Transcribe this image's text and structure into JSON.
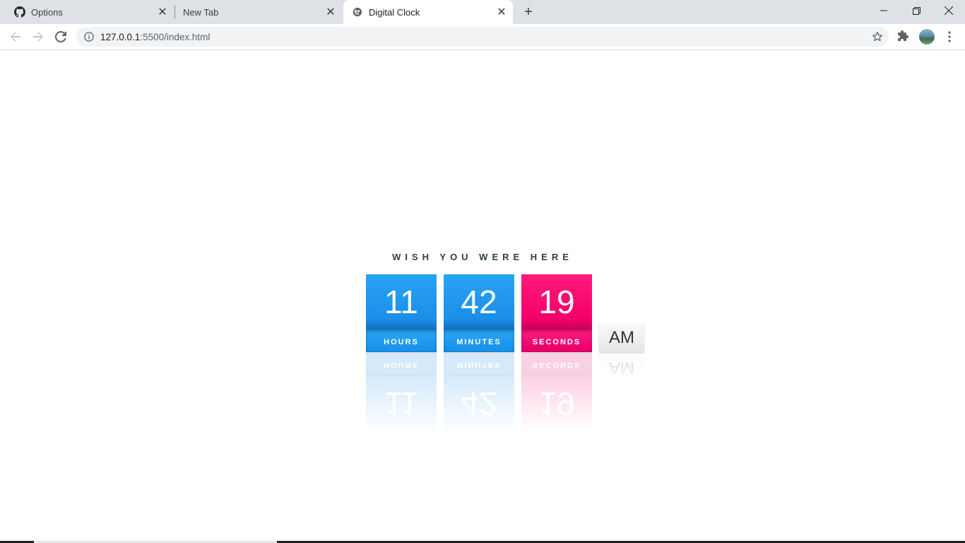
{
  "browser": {
    "tabs": [
      {
        "title": "Options",
        "icon": "github-icon",
        "active": false
      },
      {
        "title": "New Tab",
        "icon": "",
        "active": false
      },
      {
        "title": "Digital Clock",
        "icon": "globe-icon",
        "active": true
      }
    ],
    "url_host": "127.0.0.1",
    "url_path": ":5500/index.html"
  },
  "page": {
    "heading": "WISH YOU WERE HERE",
    "hours": {
      "value": "11",
      "label": "HOURS",
      "color": "#1a8fe8"
    },
    "minutes": {
      "value": "42",
      "label": "MINUTES",
      "color": "#1a8fe8"
    },
    "seconds": {
      "value": "19",
      "label": "SECONDS",
      "color": "#f5006a"
    },
    "meridiem": "AM"
  }
}
